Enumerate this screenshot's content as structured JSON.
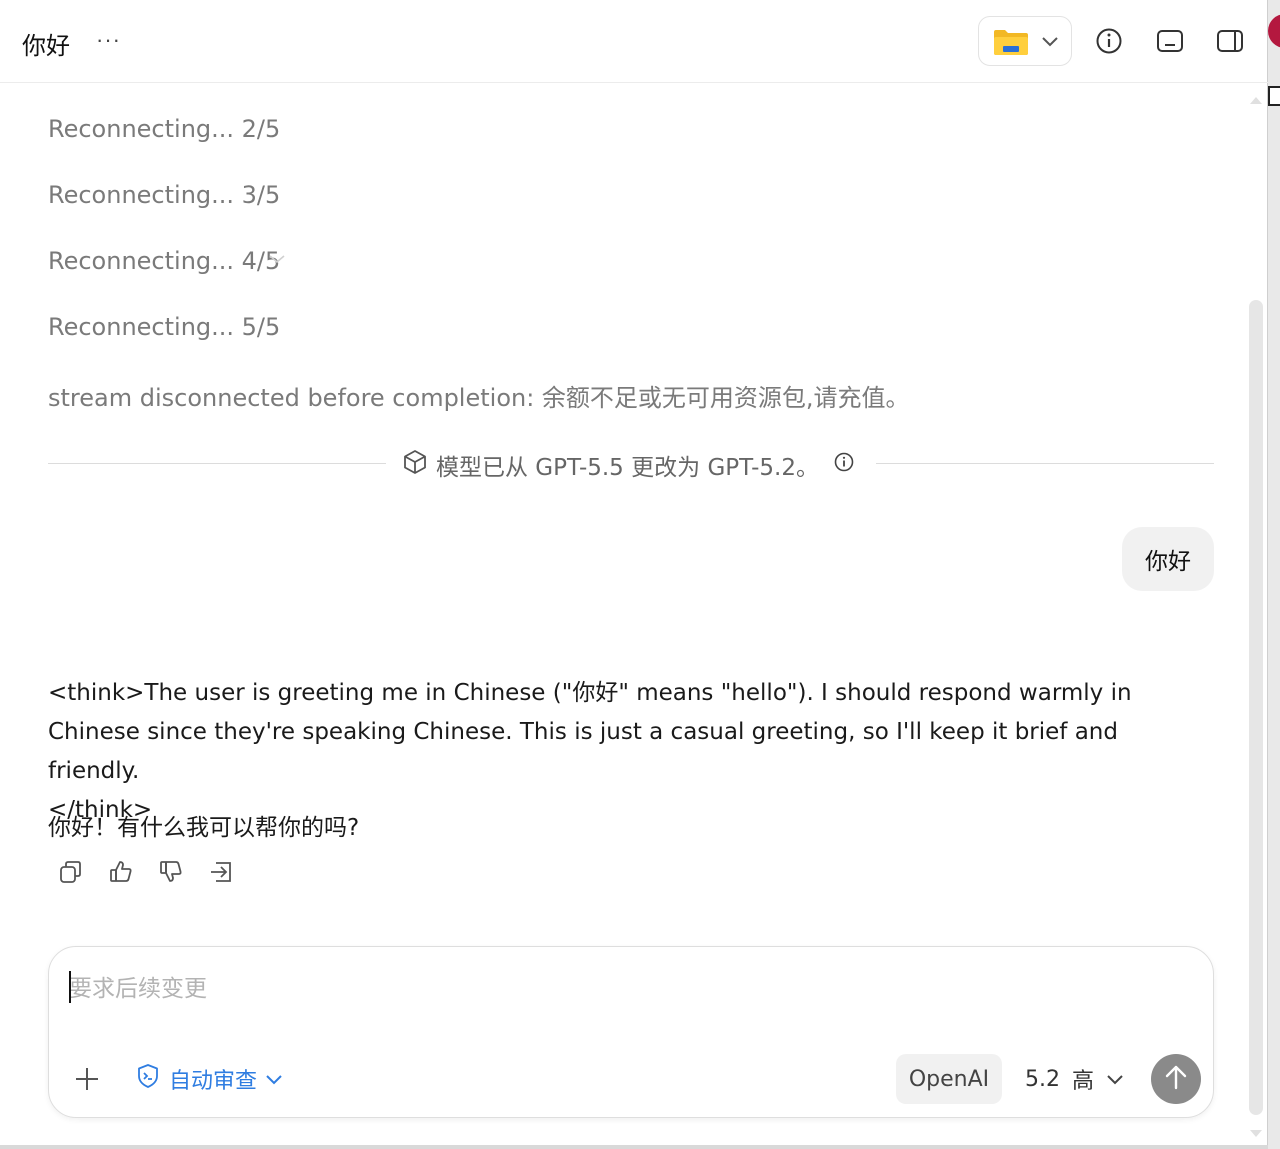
{
  "header": {
    "title": "你好",
    "more_label": "···",
    "folder_icon": "folder-icon",
    "icons": [
      "info-icon",
      "panel-bottom-icon",
      "panel-right-icon"
    ]
  },
  "messages": {
    "status_lines": [
      "Reconnecting... 2/5",
      "Reconnecting... 3/5",
      "Reconnecting... 4/5",
      "Reconnecting... 5/5",
      "stream disconnected before completion: 余额不足或无可用资源包,请充值。"
    ],
    "model_change": "模型已从 GPT-5.5 更改为 GPT-5.2。",
    "user_message": "你好",
    "assistant_think": "<think>The user is greeting me in Chinese (\"你好\" means \"hello\"). I should respond warmly in Chinese since they're speaking Chinese. This is just a casual greeting, so I'll keep it brief and friendly.",
    "assistant_think_close": "</think>",
    "assistant_reply": "你好！有什么我可以帮你的吗?"
  },
  "composer": {
    "placeholder": "要求后续变更",
    "review_label": "自动审查",
    "provider": "OpenAI",
    "model_version": "5.2",
    "effort": "高"
  },
  "colors": {
    "accent_blue": "#2f7de1",
    "status_gray": "#7a7a7a",
    "send_button": "#8a8a8a"
  }
}
